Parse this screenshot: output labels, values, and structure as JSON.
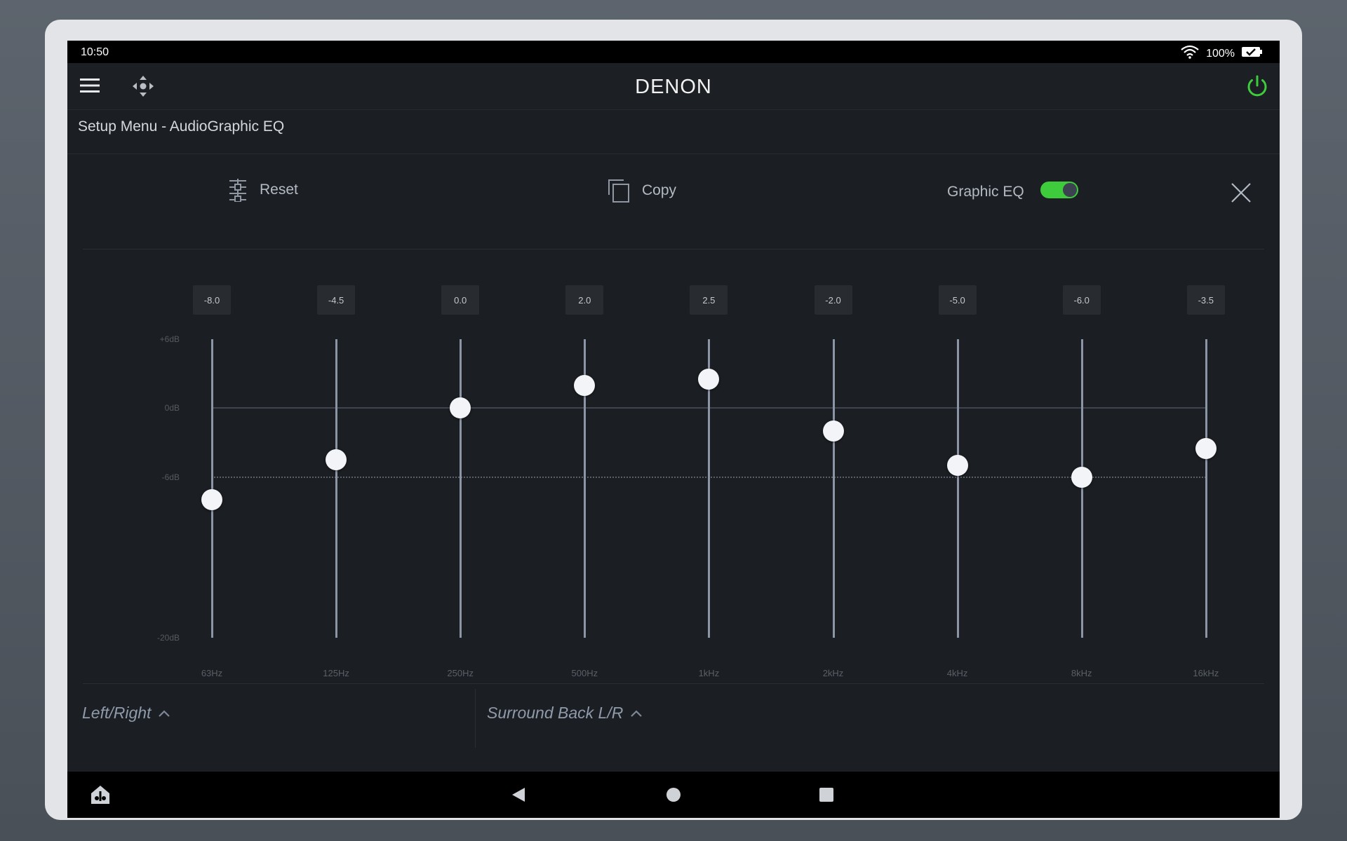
{
  "status_bar": {
    "time": "10:50",
    "battery": "100%"
  },
  "app_bar": {
    "brand": "DENON"
  },
  "page": {
    "title": "Setup Menu - AudioGraphic EQ"
  },
  "toolbar": {
    "reset_label": "Reset",
    "copy_label": "Copy",
    "graphic_eq_label": "Graphic EQ",
    "graphic_eq_enabled": true
  },
  "eq": {
    "db_labels": {
      "top": "+6dB",
      "zero": "0dB",
      "minus6": "-6dB",
      "bottom": "-20dB"
    },
    "range_db": [
      -20,
      6
    ],
    "bands": [
      {
        "freq": "63Hz",
        "value": "-8.0"
      },
      {
        "freq": "125Hz",
        "value": "-4.5"
      },
      {
        "freq": "250Hz",
        "value": "0.0"
      },
      {
        "freq": "500Hz",
        "value": "2.0"
      },
      {
        "freq": "1kHz",
        "value": "2.5"
      },
      {
        "freq": "2kHz",
        "value": "-2.0"
      },
      {
        "freq": "4kHz",
        "value": "-5.0"
      },
      {
        "freq": "8kHz",
        "value": "-6.0"
      },
      {
        "freq": "16kHz",
        "value": "-3.5"
      }
    ]
  },
  "channels": {
    "left_right": "Left/Right",
    "surround_back": "Surround Back L/R"
  },
  "colors": {
    "accent_green": "#3ecb3c",
    "toggle_knob": "#3c4250",
    "track": "#8c95a6"
  }
}
